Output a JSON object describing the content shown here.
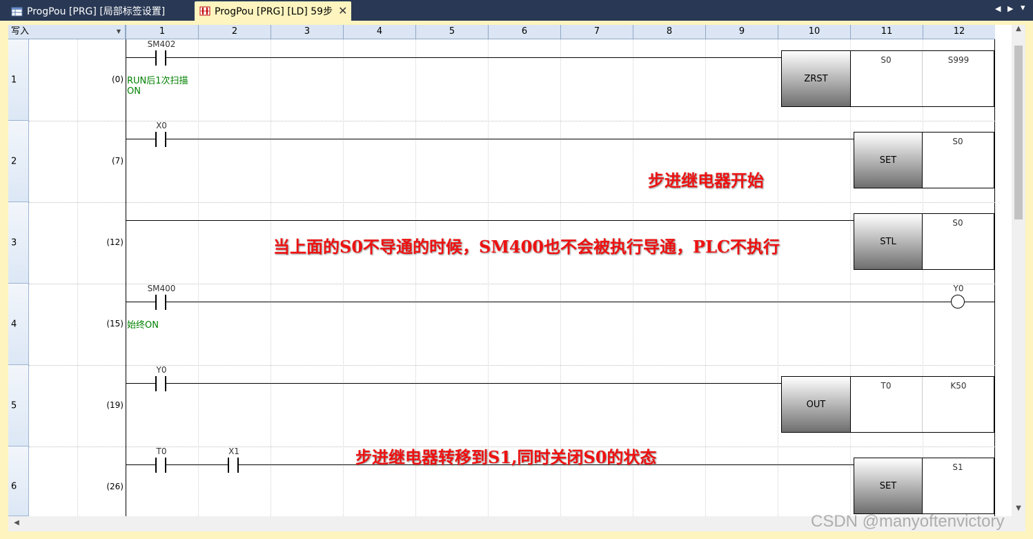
{
  "tabs": [
    {
      "label": "ProgPou [PRG] [局部标签设置]",
      "active": false
    },
    {
      "label": "ProgPou [PRG] [LD] 59步",
      "active": true
    }
  ],
  "editor": {
    "mode_label": "写入",
    "columns": [
      "1",
      "2",
      "3",
      "4",
      "5",
      "6",
      "7",
      "8",
      "9",
      "10",
      "11",
      "12"
    ],
    "rows": [
      {
        "num": "1",
        "step": "(0)"
      },
      {
        "num": "2",
        "step": "(7)"
      },
      {
        "num": "3",
        "step": "(12)"
      },
      {
        "num": "4",
        "step": "(15)"
      },
      {
        "num": "5",
        "step": "(19)"
      },
      {
        "num": "6",
        "step": "(26)"
      }
    ],
    "contacts": [
      "SM402",
      "X0",
      "SM400",
      "Y0",
      "T0",
      "X1"
    ],
    "comments": {
      "r1_line1": "RUN后1次扫描",
      "r1_line2": "ON",
      "r4": "始终ON"
    },
    "instructions": {
      "r1": {
        "name": "ZRST",
        "arg1": "S0",
        "arg2": "S999"
      },
      "r2": {
        "name": "SET",
        "arg": "S0"
      },
      "r3": {
        "name": "STL",
        "arg": "S0"
      },
      "r4": {
        "coil": "Y0"
      },
      "r5": {
        "name": "OUT",
        "arg1": "T0",
        "arg2": "K50"
      },
      "r6": {
        "name": "SET",
        "arg": "S1"
      }
    }
  },
  "annotations": [
    "步进继电器开始",
    "当上面的S0不导通的时候，SM400也不会被执行导通，PLC不执行",
    "步进继电器转移到S1,同时关闭S0的状态"
  ],
  "watermark": "CSDN @manyoftenvictory",
  "colors": {
    "annotation": "#ee1111",
    "comment": "#008000",
    "tab_active_bg": "#fdf4bf",
    "chrome_bg": "#293955"
  }
}
